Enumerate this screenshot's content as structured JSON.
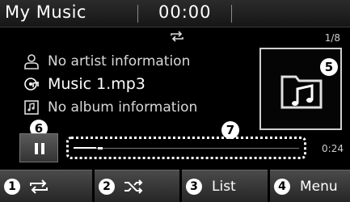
{
  "header": {
    "title": "My Music",
    "clock": "00:00"
  },
  "playlist": {
    "track_count": "1/8",
    "repeat_icon": "repeat-icon"
  },
  "track": {
    "artist": "No artist information",
    "title": "Music 1.mp3",
    "album": "No album information"
  },
  "album_art": {
    "icon": "music-folder-icon"
  },
  "player": {
    "pause_icon": "pause-icon",
    "progress": 0.1,
    "total_time": "0:24"
  },
  "callouts": {
    "five": "5",
    "six": "6",
    "seven": "7"
  },
  "bottom_bar": [
    {
      "num": "1",
      "icon": "repeat-icon",
      "label": ""
    },
    {
      "num": "2",
      "icon": "shuffle-icon",
      "label": ""
    },
    {
      "num": "3",
      "icon": "",
      "label": "List"
    },
    {
      "num": "4",
      "icon": "",
      "label": "Menu"
    }
  ]
}
